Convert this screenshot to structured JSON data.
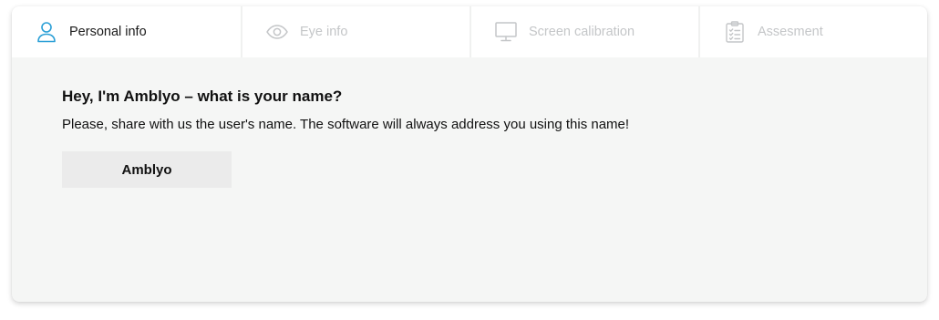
{
  "tabs": [
    {
      "label": "Personal info",
      "icon": "user-icon",
      "active": true
    },
    {
      "label": "Eye info",
      "icon": "eye-icon",
      "active": false
    },
    {
      "label": "Screen calibration",
      "icon": "monitor-icon",
      "active": false
    },
    {
      "label": "Assesment",
      "icon": "clipboard-checklist-icon",
      "active": false
    }
  ],
  "form": {
    "title": "Hey, I'm Amblyo – what is your name?",
    "description": "Please, share with us the user's name. The software will always address you using this name!",
    "name_value": "Amblyo"
  },
  "colors": {
    "accent": "#2a9fd6",
    "inactive": "#c4c6c8",
    "panel_background": "#f5f6f5",
    "input_background": "#ebebeb"
  }
}
